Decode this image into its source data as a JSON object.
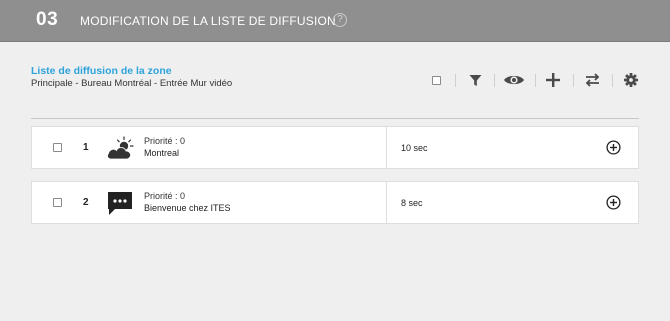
{
  "header": {
    "step_number": "03",
    "title": "MODIFICATION DE LA LISTE DE DIFFUSION",
    "help_glyph": "?"
  },
  "zone": {
    "title": "Liste de diffusion de la zone",
    "path": "Principale - Bureau Montréal - Entrée Mur vidéo"
  },
  "toolbar": {
    "icons": [
      "select-all-checkbox",
      "filter-icon",
      "eye-icon",
      "plus-icon",
      "swap-arrows-icon",
      "gear-icon"
    ]
  },
  "items": [
    {
      "number": "1",
      "priority": "Priorité : 0",
      "name": "Montreal",
      "duration": "10 sec",
      "icon": "weather-cloud-sun-icon"
    },
    {
      "number": "2",
      "priority": "Priorité : 0",
      "name": "Bienvenue chez ITES",
      "duration": "8 sec",
      "icon": "message-bubble-icon"
    }
  ],
  "colors": {
    "header_bg": "#8f8f8f",
    "accent": "#2da3dc",
    "page_bg": "#efefef"
  }
}
